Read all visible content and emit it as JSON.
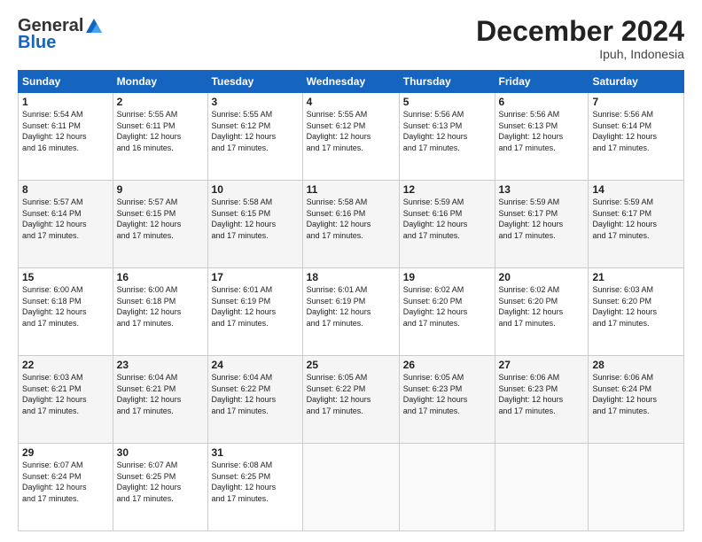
{
  "header": {
    "logo_general": "General",
    "logo_blue": "Blue",
    "month_title": "December 2024",
    "location": "Ipuh, Indonesia"
  },
  "calendar": {
    "days_of_week": [
      "Sunday",
      "Monday",
      "Tuesday",
      "Wednesday",
      "Thursday",
      "Friday",
      "Saturday"
    ],
    "weeks": [
      [
        {
          "day": "1",
          "info": "Sunrise: 5:54 AM\nSunset: 6:11 PM\nDaylight: 12 hours\nand 16 minutes."
        },
        {
          "day": "2",
          "info": "Sunrise: 5:55 AM\nSunset: 6:11 PM\nDaylight: 12 hours\nand 16 minutes."
        },
        {
          "day": "3",
          "info": "Sunrise: 5:55 AM\nSunset: 6:12 PM\nDaylight: 12 hours\nand 17 minutes."
        },
        {
          "day": "4",
          "info": "Sunrise: 5:55 AM\nSunset: 6:12 PM\nDaylight: 12 hours\nand 17 minutes."
        },
        {
          "day": "5",
          "info": "Sunrise: 5:56 AM\nSunset: 6:13 PM\nDaylight: 12 hours\nand 17 minutes."
        },
        {
          "day": "6",
          "info": "Sunrise: 5:56 AM\nSunset: 6:13 PM\nDaylight: 12 hours\nand 17 minutes."
        },
        {
          "day": "7",
          "info": "Sunrise: 5:56 AM\nSunset: 6:14 PM\nDaylight: 12 hours\nand 17 minutes."
        }
      ],
      [
        {
          "day": "8",
          "info": "Sunrise: 5:57 AM\nSunset: 6:14 PM\nDaylight: 12 hours\nand 17 minutes."
        },
        {
          "day": "9",
          "info": "Sunrise: 5:57 AM\nSunset: 6:15 PM\nDaylight: 12 hours\nand 17 minutes."
        },
        {
          "day": "10",
          "info": "Sunrise: 5:58 AM\nSunset: 6:15 PM\nDaylight: 12 hours\nand 17 minutes."
        },
        {
          "day": "11",
          "info": "Sunrise: 5:58 AM\nSunset: 6:16 PM\nDaylight: 12 hours\nand 17 minutes."
        },
        {
          "day": "12",
          "info": "Sunrise: 5:59 AM\nSunset: 6:16 PM\nDaylight: 12 hours\nand 17 minutes."
        },
        {
          "day": "13",
          "info": "Sunrise: 5:59 AM\nSunset: 6:17 PM\nDaylight: 12 hours\nand 17 minutes."
        },
        {
          "day": "14",
          "info": "Sunrise: 5:59 AM\nSunset: 6:17 PM\nDaylight: 12 hours\nand 17 minutes."
        }
      ],
      [
        {
          "day": "15",
          "info": "Sunrise: 6:00 AM\nSunset: 6:18 PM\nDaylight: 12 hours\nand 17 minutes."
        },
        {
          "day": "16",
          "info": "Sunrise: 6:00 AM\nSunset: 6:18 PM\nDaylight: 12 hours\nand 17 minutes."
        },
        {
          "day": "17",
          "info": "Sunrise: 6:01 AM\nSunset: 6:19 PM\nDaylight: 12 hours\nand 17 minutes."
        },
        {
          "day": "18",
          "info": "Sunrise: 6:01 AM\nSunset: 6:19 PM\nDaylight: 12 hours\nand 17 minutes."
        },
        {
          "day": "19",
          "info": "Sunrise: 6:02 AM\nSunset: 6:20 PM\nDaylight: 12 hours\nand 17 minutes."
        },
        {
          "day": "20",
          "info": "Sunrise: 6:02 AM\nSunset: 6:20 PM\nDaylight: 12 hours\nand 17 minutes."
        },
        {
          "day": "21",
          "info": "Sunrise: 6:03 AM\nSunset: 6:20 PM\nDaylight: 12 hours\nand 17 minutes."
        }
      ],
      [
        {
          "day": "22",
          "info": "Sunrise: 6:03 AM\nSunset: 6:21 PM\nDaylight: 12 hours\nand 17 minutes."
        },
        {
          "day": "23",
          "info": "Sunrise: 6:04 AM\nSunset: 6:21 PM\nDaylight: 12 hours\nand 17 minutes."
        },
        {
          "day": "24",
          "info": "Sunrise: 6:04 AM\nSunset: 6:22 PM\nDaylight: 12 hours\nand 17 minutes."
        },
        {
          "day": "25",
          "info": "Sunrise: 6:05 AM\nSunset: 6:22 PM\nDaylight: 12 hours\nand 17 minutes."
        },
        {
          "day": "26",
          "info": "Sunrise: 6:05 AM\nSunset: 6:23 PM\nDaylight: 12 hours\nand 17 minutes."
        },
        {
          "day": "27",
          "info": "Sunrise: 6:06 AM\nSunset: 6:23 PM\nDaylight: 12 hours\nand 17 minutes."
        },
        {
          "day": "28",
          "info": "Sunrise: 6:06 AM\nSunset: 6:24 PM\nDaylight: 12 hours\nand 17 minutes."
        }
      ],
      [
        {
          "day": "29",
          "info": "Sunrise: 6:07 AM\nSunset: 6:24 PM\nDaylight: 12 hours\nand 17 minutes."
        },
        {
          "day": "30",
          "info": "Sunrise: 6:07 AM\nSunset: 6:25 PM\nDaylight: 12 hours\nand 17 minutes."
        },
        {
          "day": "31",
          "info": "Sunrise: 6:08 AM\nSunset: 6:25 PM\nDaylight: 12 hours\nand 17 minutes."
        },
        {
          "day": "",
          "info": ""
        },
        {
          "day": "",
          "info": ""
        },
        {
          "day": "",
          "info": ""
        },
        {
          "day": "",
          "info": ""
        }
      ]
    ]
  }
}
